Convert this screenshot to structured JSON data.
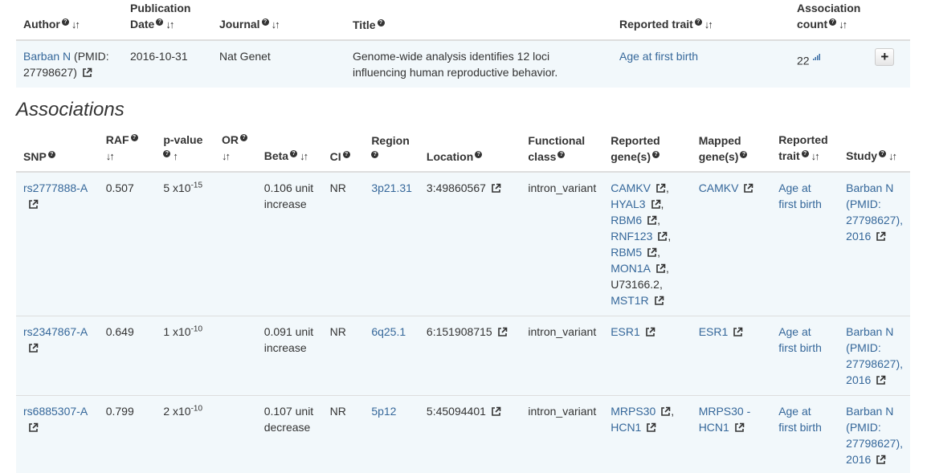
{
  "study_table": {
    "headers": {
      "author": "Author",
      "publication_date": "Publication Date",
      "journal": "Journal",
      "title": "Title",
      "reported_trait": "Reported trait",
      "association_count": "Association count"
    },
    "row": {
      "author_link": "Barban N",
      "author_pmid": "(PMID: 27798627)",
      "publication_date": "2016-10-31",
      "journal": "Nat Genet",
      "title": "Genome-wide analysis identifies 12 loci influencing human reproductive behavior.",
      "reported_trait": "Age at first birth",
      "association_count": "22",
      "expand_label": "+"
    }
  },
  "associations": {
    "title": "Associations",
    "headers": {
      "snp": "SNP",
      "raf": "RAF",
      "pvalue": "p-value",
      "or": "OR",
      "beta": "Beta",
      "ci": "CI",
      "region": "Region",
      "location": "Location",
      "functional_class": "Functional class",
      "reported_genes": "Reported gene(s)",
      "mapped_genes": "Mapped gene(s)",
      "reported_trait": "Reported trait",
      "study": "Study"
    },
    "rows": [
      {
        "snp": "rs2777888-A",
        "raf": "0.507",
        "pvalue_mantissa": "5 x10",
        "pvalue_exp": "-15",
        "or": "",
        "beta": "0.106 unit increase",
        "ci": "NR",
        "region": "3p21.31",
        "location": "3:49860567",
        "functional_class": "intron_variant",
        "reported_genes": [
          "CAMKV",
          "HYAL3",
          "RBM6",
          "RNF123",
          "RBM5",
          "MON1A",
          "U73166.2",
          "MST1R"
        ],
        "mapped_genes": "CAMKV",
        "reported_trait": "Age at first birth",
        "study": "Barban N (PMID: 27798627), 2016"
      },
      {
        "snp": "rs2347867-A",
        "raf": "0.649",
        "pvalue_mantissa": "1 x10",
        "pvalue_exp": "-10",
        "or": "",
        "beta": "0.091 unit increase",
        "ci": "NR",
        "region": "6q25.1",
        "location": "6:151908715",
        "functional_class": "intron_variant",
        "reported_genes": [
          "ESR1"
        ],
        "mapped_genes": "ESR1",
        "reported_trait": "Age at first birth",
        "study": "Barban N (PMID: 27798627), 2016"
      },
      {
        "snp": "rs6885307-A",
        "raf": "0.799",
        "pvalue_mantissa": "2 x10",
        "pvalue_exp": "-10",
        "or": "",
        "beta": "0.107 unit decrease",
        "ci": "NR",
        "region": "5p12",
        "location": "5:45094401",
        "functional_class": "intron_variant",
        "reported_genes": [
          "MRPS30",
          "HCN1"
        ],
        "mapped_genes": "MRPS30 - HCN1",
        "reported_trait": "Age at first birth",
        "study": "Barban N (PMID: 27798627), 2016"
      }
    ]
  }
}
